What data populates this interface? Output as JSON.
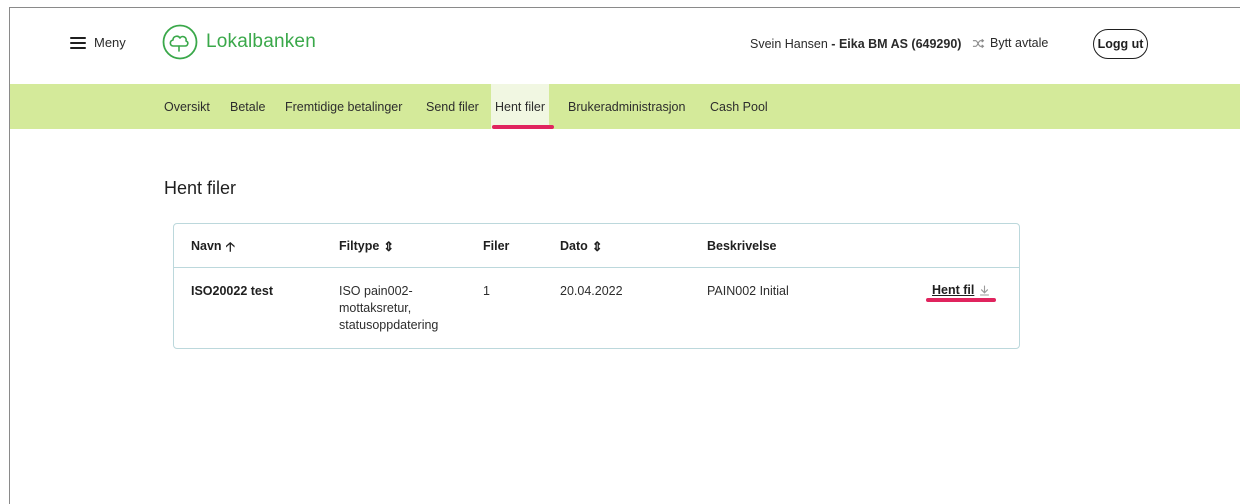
{
  "header": {
    "menu_label": "Meny",
    "logo_text": "Lokalbanken",
    "user_name": "Svein Hansen",
    "separator": " - ",
    "org": "Eika BM AS (649290)",
    "switch_label": "Bytt avtale",
    "logout_label": "Logg ut"
  },
  "nav": {
    "items": [
      {
        "label": "Oversikt"
      },
      {
        "label": "Betale"
      },
      {
        "label": "Fremtidige betalinger"
      },
      {
        "label": "Send filer"
      },
      {
        "label": "Hent filer"
      },
      {
        "label": "Brukeradministrasjon"
      },
      {
        "label": "Cash Pool"
      }
    ],
    "active": "Hent filer"
  },
  "main": {
    "title": "Hent filer",
    "table": {
      "headers": {
        "name": "Navn",
        "filetype": "Filtype",
        "files": "Filer",
        "date": "Dato",
        "description": "Beskrivelse"
      },
      "rows": [
        {
          "name": "ISO20022 test",
          "filetype_l1": "ISO pain002-",
          "filetype_l2": "mottaksretur,",
          "filetype_l3": "statusoppdatering",
          "files": "1",
          "date": "20.04.2022",
          "description": "PAIN002 Initial",
          "action": "Hent fil"
        }
      ]
    }
  },
  "colors": {
    "brand_green": "#3aa84a",
    "nav_bg": "#d4ea9a",
    "highlight": "#e0245e",
    "table_border": "#bcd8dc"
  }
}
